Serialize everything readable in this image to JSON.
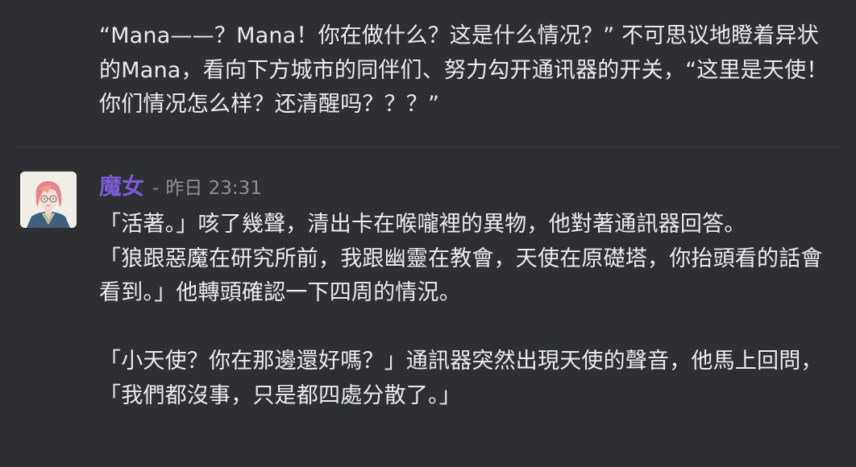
{
  "messages": {
    "previous": {
      "text": "“Mana——？Mana！你在做什么？这是什么情况？” 不可思议地瞪着异状的Mana，看向下方城市的同伴们、努力勾开通讯器的开关，“这里是天使！你们情况怎么样？还清醒吗？？？”"
    },
    "current": {
      "author": "魔女",
      "separator": "-",
      "timestamp": "昨日 23:31",
      "text": "「活著。」咳了幾聲，清出卡在喉嚨裡的異物，他對著通訊器回答。\n「狼跟惡魔在研究所前，我跟幽靈在教會，天使在原礎塔，你抬頭看的話會看到。」他轉頭確認一下四周的情況。\n\n「小天使？你在那邊還好嗎？」通訊器突然出現天使的聲音，他馬上回問，「我們都沒事，只是都四處分散了。」"
    }
  },
  "colors": {
    "background": "#2e2f33",
    "text": "#ececee",
    "username": "#7c5cd6",
    "timestamp": "#8e8f95",
    "divider": "#3d3e43"
  },
  "avatar": {
    "icon": "anime-character-avatar"
  }
}
